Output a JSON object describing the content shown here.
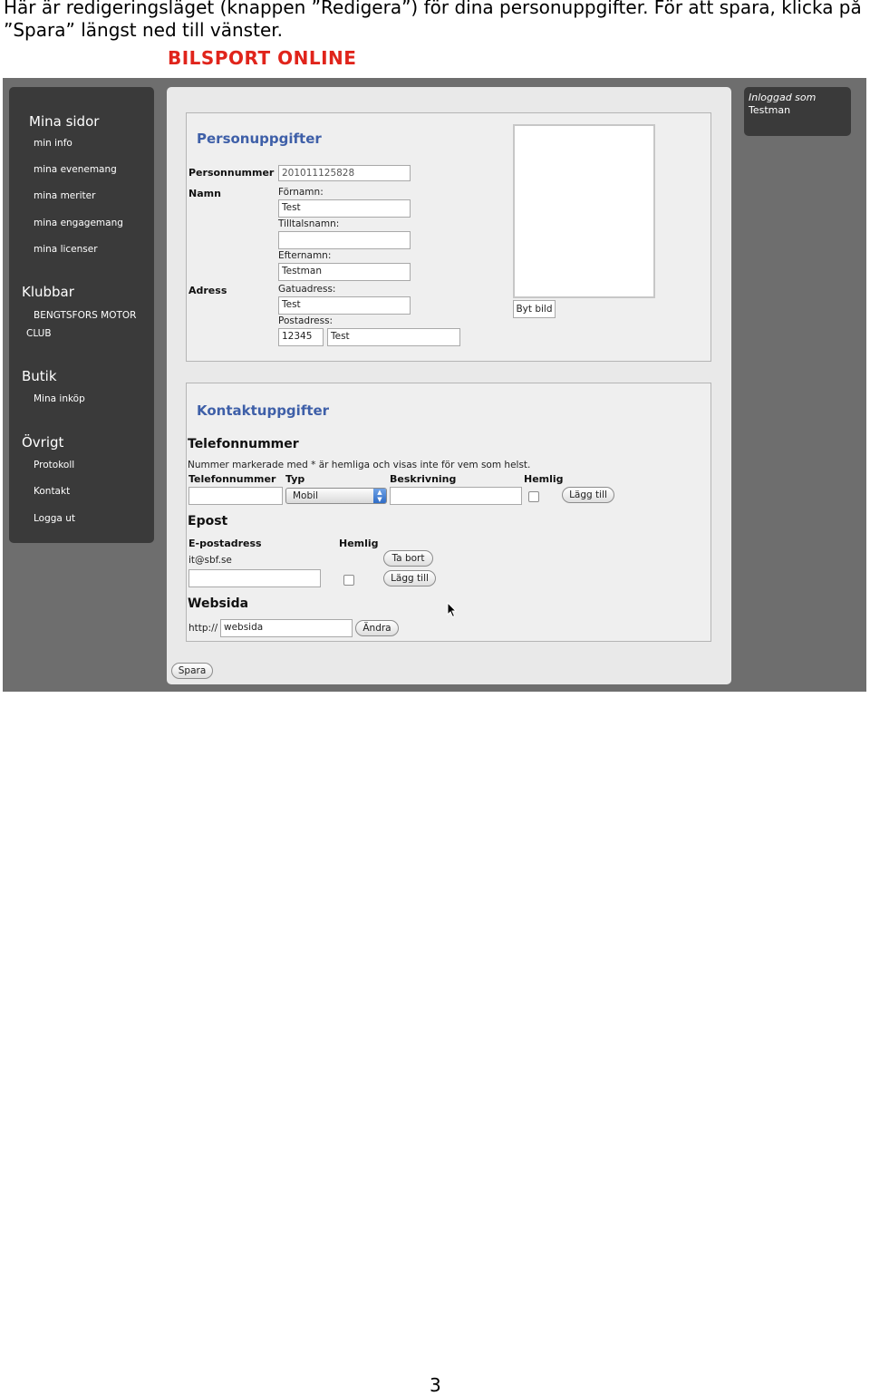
{
  "intro_text": "Här är redigeringsläget (knappen ”Redigera”) för dina personuppgifter. För att spara, klicka på ”Spara” längst ned till vänster.",
  "brand": "BILSPORT ONLINE",
  "sidebar": {
    "mina_sidor": {
      "title": "Mina sidor",
      "items": [
        "min info",
        "mina evenemang",
        "mina meriter",
        "mina engagemang",
        "mina licenser"
      ]
    },
    "klubbar": {
      "title": "Klubbar",
      "club_line1": "BENGTSFORS MOTOR",
      "club_line2": "CLUB"
    },
    "butik": {
      "title": "Butik",
      "items": [
        "Mina inköp"
      ]
    },
    "ovrigt": {
      "title": "Övrigt",
      "items": [
        "Protokoll",
        "Kontakt",
        "Logga ut"
      ]
    }
  },
  "login": {
    "label": "Inloggad som",
    "user": "Testman"
  },
  "person": {
    "title": "Personuppgifter",
    "personnummer_label": "Personnummer",
    "personnummer_value": "201011125828",
    "namn_label": "Namn",
    "fornamn_label": "Förnamn:",
    "fornamn_value": "Test",
    "tilltalsnamn_label": "Tilltalsnamn:",
    "tilltalsnamn_value": "",
    "efternamn_label": "Efternamn:",
    "efternamn_value": "Testman",
    "adress_label": "Adress",
    "gatuadress_label": "Gatuadress:",
    "gatuadress_value": "Test",
    "postadress_label": "Postadress:",
    "postnummer_value": "12345",
    "ort_value": "Test",
    "change_photo_label": "Byt bild"
  },
  "contact": {
    "title": "Kontaktuppgifter",
    "phone_section": "Telefonnummer",
    "phone_note": "Nummer markerade med * är hemliga och visas inte för vem som helst.",
    "col_phone": "Telefonnummer",
    "col_type": "Typ",
    "col_desc": "Beskrivning",
    "col_secret": "Hemlig",
    "type_selected": "Mobil",
    "phone_add": "Lägg till",
    "email_section": "Epost",
    "email_col": "E-postadress",
    "email_secret": "Hemlig",
    "email_existing": "it@sbf.se",
    "email_remove": "Ta bort",
    "email_add": "Lägg till",
    "web_section": "Websida",
    "web_prefix": "http://",
    "web_value": "websida",
    "web_change": "Ändra"
  },
  "save_label": "Spara",
  "page_number": "3",
  "colors": {
    "brand_red": "#e0241b",
    "title_blue": "#3e5fa8",
    "sidebar": "#3a3a3a",
    "frame": "#6e6e6e"
  }
}
